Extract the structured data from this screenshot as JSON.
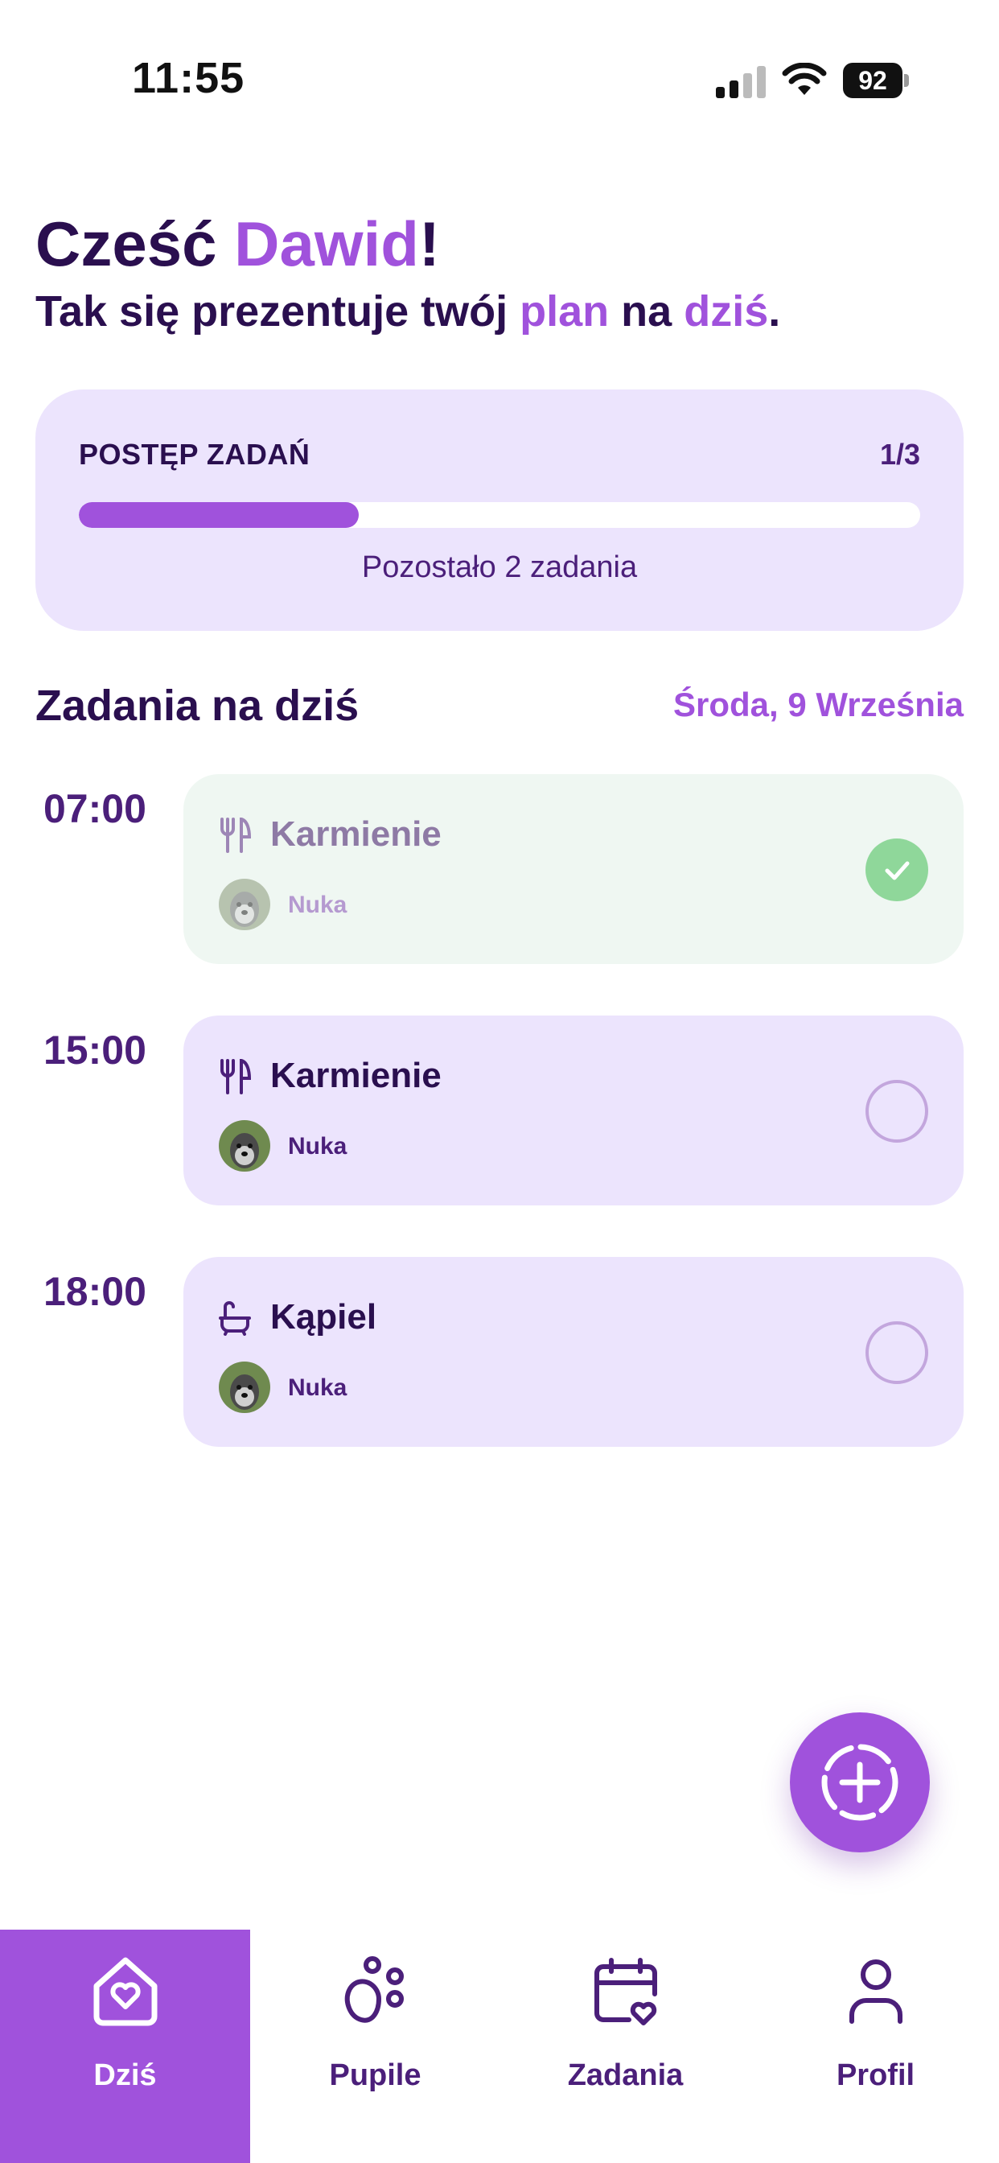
{
  "status_bar": {
    "time": "11:55",
    "battery": "92"
  },
  "greeting": {
    "prefix": "Cześć ",
    "name": "Dawid",
    "suffix": "!"
  },
  "subtitle": {
    "part1": "Tak się prezentuje twój ",
    "accent1": "plan",
    "part2": " na ",
    "accent2": "dziś",
    "part3": "."
  },
  "progress": {
    "label": "POSTĘP ZADAŃ",
    "count": "1/3",
    "fraction": 0.333,
    "remaining_text": "Pozostało 2 zadania"
  },
  "tasks_section": {
    "title": "Zadania na dziś",
    "date": "Środa, 9 Września"
  },
  "tasks": [
    {
      "time": "07:00",
      "title": "Karmienie",
      "pet": "Nuka",
      "icon": "fork-knife-icon",
      "done": true
    },
    {
      "time": "15:00",
      "title": "Karmienie",
      "pet": "Nuka",
      "icon": "fork-knife-icon",
      "done": false
    },
    {
      "time": "18:00",
      "title": "Kąpiel",
      "pet": "Nuka",
      "icon": "bathtub-icon",
      "done": false
    }
  ],
  "fab": {
    "icon": "add-circle-icon"
  },
  "nav": {
    "items": [
      {
        "label": "Dziś",
        "icon": "home-heart-icon",
        "active": true
      },
      {
        "label": "Pupile",
        "icon": "paw-icon",
        "active": false
      },
      {
        "label": "Zadania",
        "icon": "calendar-heart-icon",
        "active": false
      },
      {
        "label": "Profil",
        "icon": "user-icon",
        "active": false
      }
    ]
  },
  "colors": {
    "accent": "#a052dc",
    "dark_text": "#2a0f4f",
    "card_bg": "#ece4fd",
    "done_card_bg": "#eff7f2",
    "check_green": "#8fd79a"
  }
}
